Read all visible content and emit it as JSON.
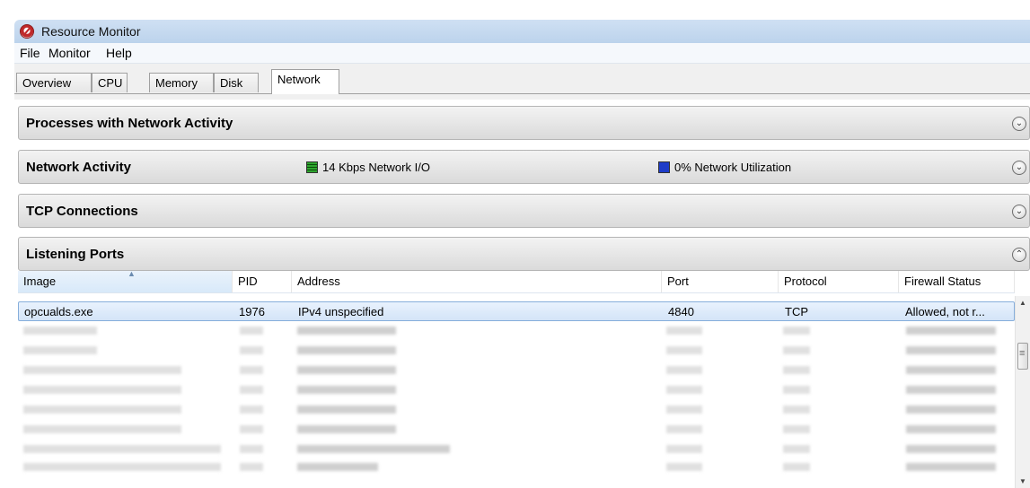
{
  "window": {
    "title": "Resource Monitor"
  },
  "menu": [
    "File",
    "Monitor",
    "Help"
  ],
  "tabs": [
    "Overview",
    "CPU",
    "Memory",
    "Disk",
    "Network"
  ],
  "sections": {
    "processes": {
      "title": "Processes with Network Activity",
      "state_icon": "chevron-down-icon"
    },
    "activity": {
      "title": "Network Activity",
      "io_label": "14 Kbps Network I/O",
      "util_label": "0% Network Utilization",
      "state_icon": "chevron-down-icon"
    },
    "tcp": {
      "title": "TCP Connections",
      "state_icon": "chevron-down-icon"
    },
    "listening": {
      "title": "Listening Ports",
      "state_icon": "chevron-up-icon"
    }
  },
  "table": {
    "columns": [
      "Image",
      "PID",
      "Address",
      "Port",
      "Protocol",
      "Firewall Status"
    ],
    "sorted_column": "Image",
    "rows": [
      {
        "image": "opcualds.exe",
        "pid": "1976",
        "address": "IPv4 unspecified",
        "port": "4840",
        "protocol": "TCP",
        "firewall": "Allowed, not r..."
      }
    ]
  },
  "colors": {
    "io_swatch": "#2fa52f",
    "util_swatch": "#1e3cc8",
    "selection": "#d3e4f8"
  }
}
